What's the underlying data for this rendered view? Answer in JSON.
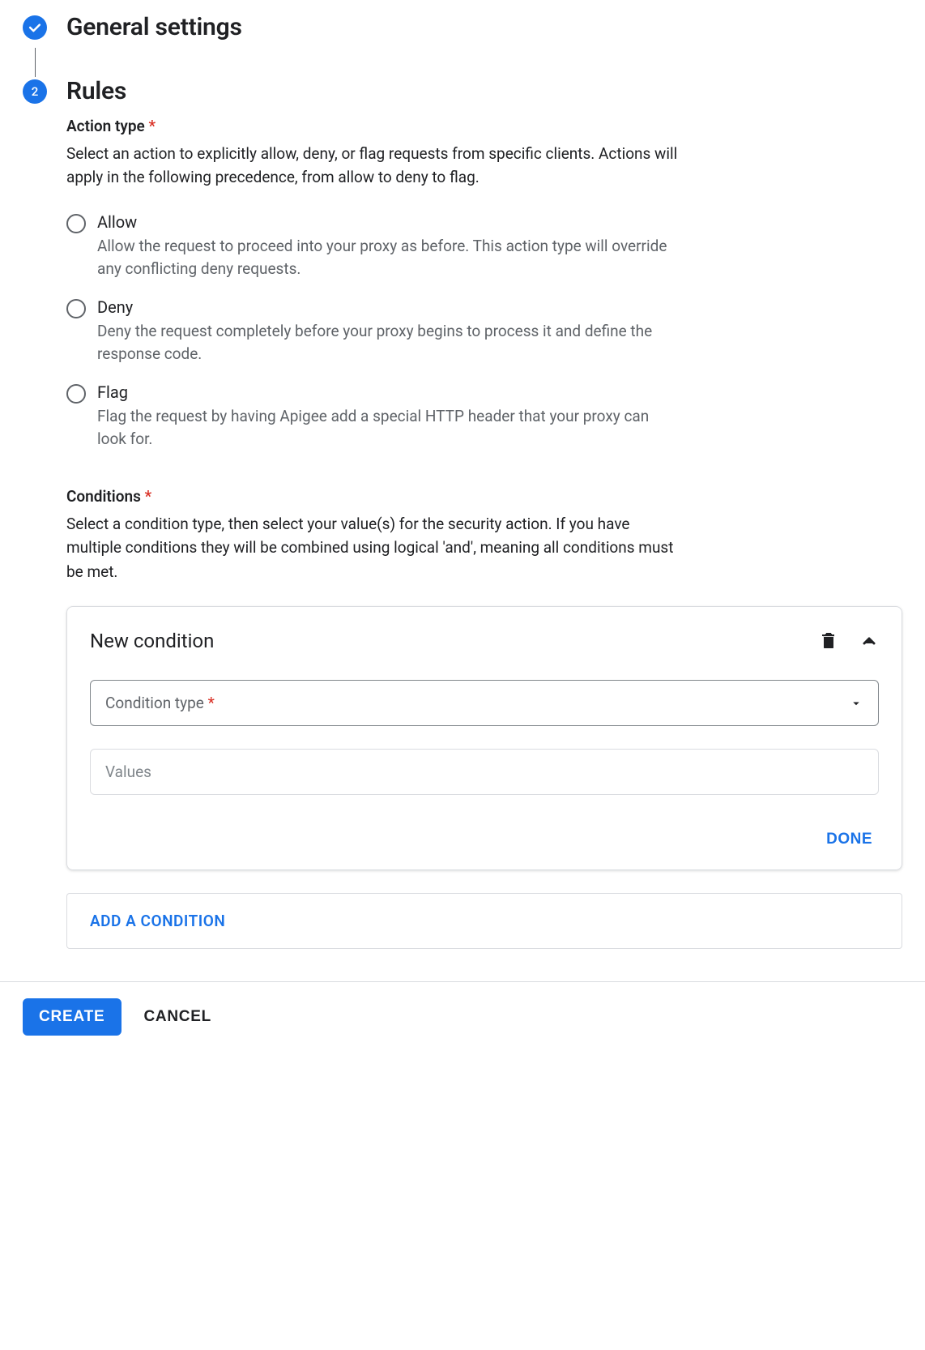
{
  "steps": {
    "step1": {
      "title": "General settings",
      "completed": true
    },
    "step2": {
      "number": "2",
      "title": "Rules"
    }
  },
  "action_type": {
    "label": "Action type",
    "required": "*",
    "description": "Select an action to explicitly allow, deny, or flag requests from specific clients. Actions will apply in the following precedence, from allow to deny to flag.",
    "options": [
      {
        "title": "Allow",
        "desc": "Allow the request to proceed into your proxy as before. This action type will override any conflicting deny requests."
      },
      {
        "title": "Deny",
        "desc": "Deny the request completely before your proxy begins to process it and define the response code."
      },
      {
        "title": "Flag",
        "desc": "Flag the request by having Apigee add a special HTTP header that your proxy can look for."
      }
    ]
  },
  "conditions": {
    "label": "Conditions",
    "required": "*",
    "description": "Select a condition type, then select your value(s) for the security action. If you have multiple conditions they will be combined using logical 'and', meaning all conditions must be met.",
    "card": {
      "title": "New condition",
      "condition_type_label": "Condition type",
      "condition_type_required": "*",
      "values_placeholder": "Values",
      "done_label": "DONE"
    },
    "add_label": "ADD A CONDITION"
  },
  "footer": {
    "create": "CREATE",
    "cancel": "CANCEL"
  }
}
